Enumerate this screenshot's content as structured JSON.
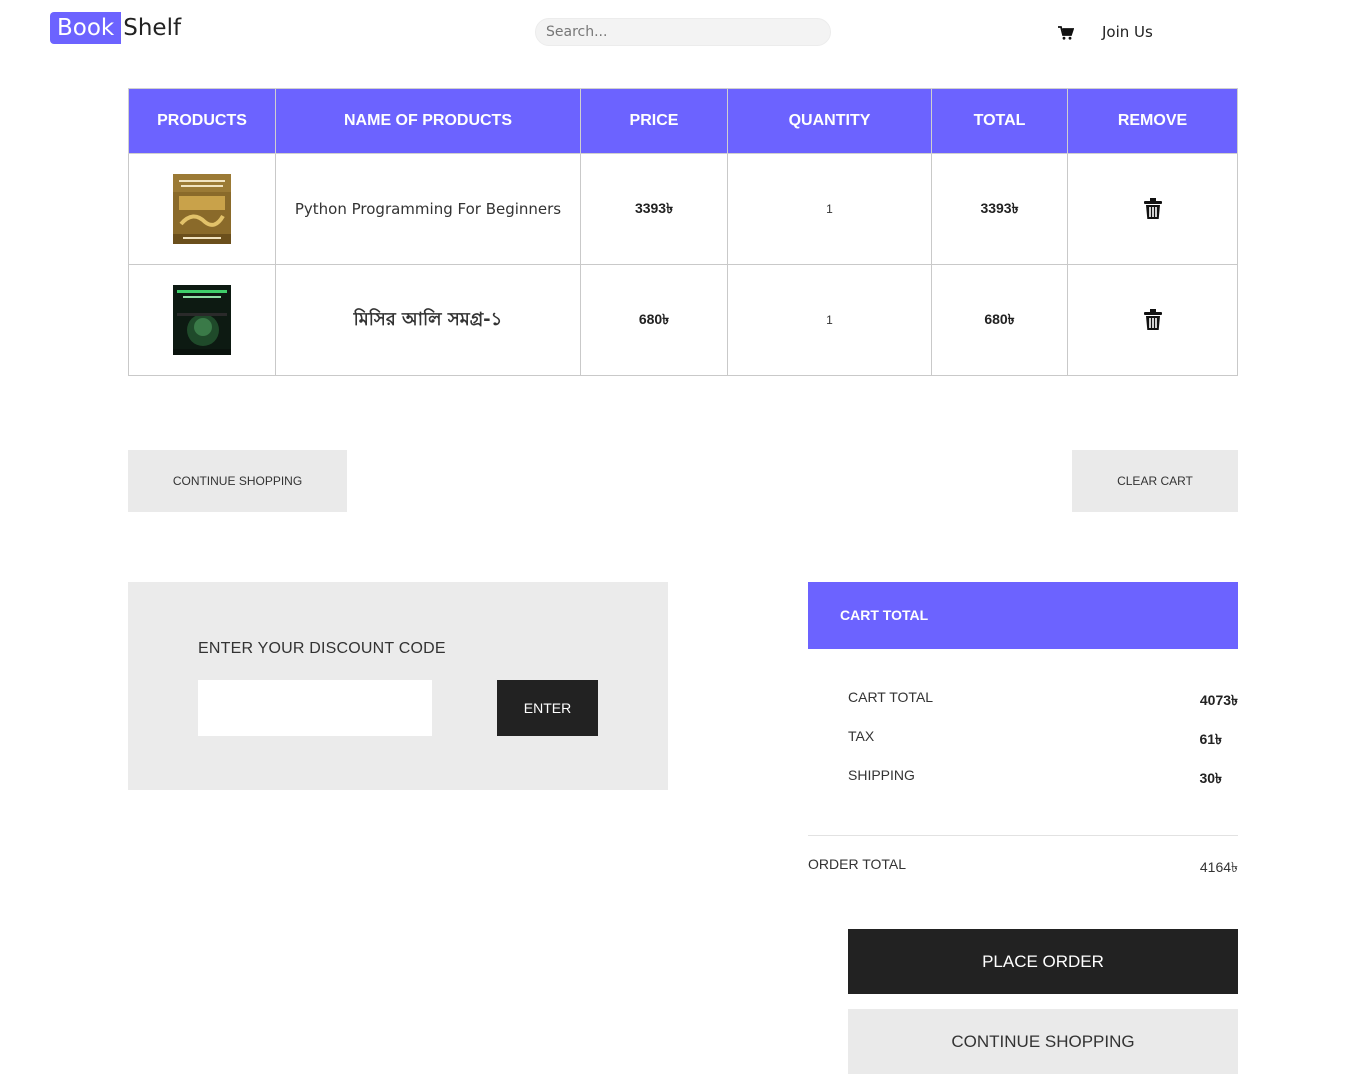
{
  "header": {
    "logo_part1": "Book",
    "logo_part2": "Shelf",
    "search_placeholder": "Search...",
    "cart_icon": "cart-icon",
    "join_label": "Join Us",
    "brand_color": "#6c63ff"
  },
  "table": {
    "headers": [
      "PRODUCTS",
      "NAME OF PRODUCTS",
      "PRICE",
      "QUANTITY",
      "TOTAL",
      "REMOVE"
    ],
    "rows": [
      {
        "name": "Python Programming For Beginners",
        "price": "3393৳",
        "quantity": "1",
        "total": "3393৳",
        "remove_icon": "trash-icon"
      },
      {
        "name": "মিসির আলি সমগ্র-১",
        "price": "680৳",
        "quantity": "1",
        "total": "680৳",
        "remove_icon": "trash-icon"
      }
    ]
  },
  "actions": {
    "continue_shopping": "CONTINUE SHOPPING",
    "clear_cart": "CLEAR CART"
  },
  "discount": {
    "title": "ENTER YOUR DISCOUNT CODE",
    "input_value": "",
    "enter_label": "ENTER"
  },
  "totals": {
    "header": "CART TOTAL",
    "cart_total_label": "CART TOTAL",
    "cart_total_value": "4073৳",
    "tax_label": "TAX",
    "tax_value": "61৳",
    "shipping_label": "SHIPPING",
    "shipping_value": "30৳",
    "order_total_label": "ORDER TOTAL",
    "order_total_value": "4164৳"
  },
  "checkout": {
    "place_order": "PLACE ORDER",
    "continue_shopping": "CONTINUE SHOPPING"
  }
}
